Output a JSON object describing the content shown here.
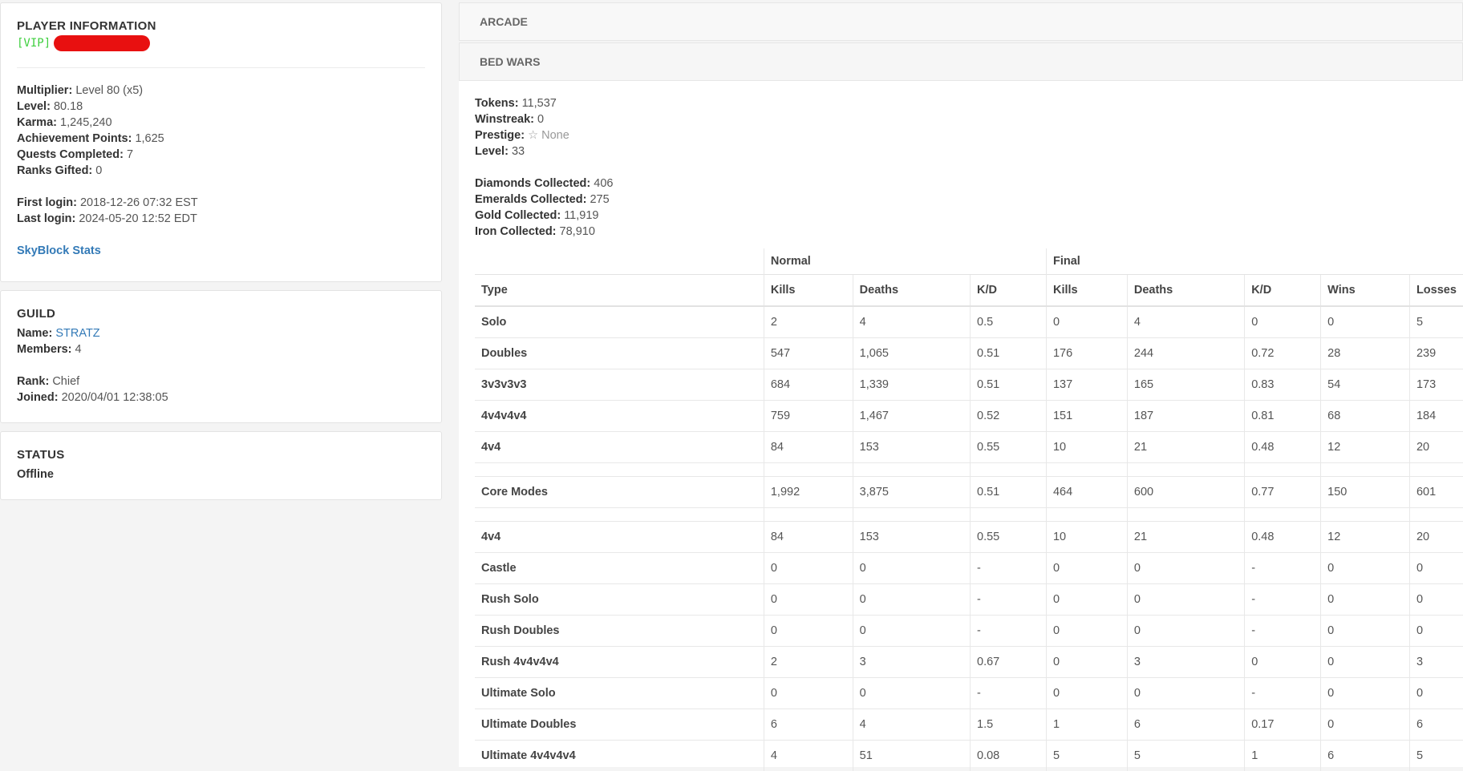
{
  "player": {
    "title": "PLAYER INFORMATION",
    "rank_tag": "[VIP]",
    "stats": [
      {
        "label": "Multiplier:",
        "value": "Level 80 (x5)"
      },
      {
        "label": "Level:",
        "value": "80.18"
      },
      {
        "label": "Karma:",
        "value": "1,245,240"
      },
      {
        "label": "Achievement Points:",
        "value": "1,625"
      },
      {
        "label": "Quests Completed:",
        "value": "7"
      },
      {
        "label": "Ranks Gifted:",
        "value": "0"
      }
    ],
    "logins": [
      {
        "label": "First login:",
        "value": "2018-12-26 07:32 EST"
      },
      {
        "label": "Last login:",
        "value": "2024-05-20 12:52 EDT"
      }
    ],
    "skyblock_link": "SkyBlock Stats"
  },
  "guild": {
    "title": "GUILD",
    "name_label": "Name:",
    "name_value": "STRATZ",
    "members_label": "Members:",
    "members_value": "4",
    "rank_label": "Rank:",
    "rank_value": "Chief",
    "joined_label": "Joined:",
    "joined_value": "2020/04/01 12:38:05"
  },
  "status": {
    "title": "STATUS",
    "value": "Offline"
  },
  "arcade": {
    "title": "ARCADE"
  },
  "bedwars": {
    "title": "BED WARS",
    "stats1": [
      {
        "label": "Tokens:",
        "value": "11,537"
      },
      {
        "label": "Winstreak:",
        "value": "0"
      },
      {
        "label": "Prestige:",
        "value": "☆ None"
      },
      {
        "label": "Level:",
        "value": "33"
      }
    ],
    "stats2": [
      {
        "label": "Diamonds Collected:",
        "value": "406"
      },
      {
        "label": "Emeralds Collected:",
        "value": "275"
      },
      {
        "label": "Gold Collected:",
        "value": "11,919"
      },
      {
        "label": "Iron Collected:",
        "value": "78,910"
      }
    ],
    "table": {
      "group_normal": "Normal",
      "group_final": "Final",
      "headers": [
        "Type",
        "Kills",
        "Deaths",
        "K/D",
        "Kills",
        "Deaths",
        "K/D",
        "Wins",
        "Losses"
      ],
      "rows": [
        [
          "Solo",
          "2",
          "4",
          "0.5",
          "0",
          "4",
          "0",
          "0",
          "5"
        ],
        [
          "Doubles",
          "547",
          "1,065",
          "0.51",
          "176",
          "244",
          "0.72",
          "28",
          "239"
        ],
        [
          "3v3v3v3",
          "684",
          "1,339",
          "0.51",
          "137",
          "165",
          "0.83",
          "54",
          "173"
        ],
        [
          "4v4v4v4",
          "759",
          "1,467",
          "0.52",
          "151",
          "187",
          "0.81",
          "68",
          "184"
        ],
        [
          "4v4",
          "84",
          "153",
          "0.55",
          "10",
          "21",
          "0.48",
          "12",
          "20"
        ]
      ],
      "core_row": [
        "Core Modes",
        "1,992",
        "3,875",
        "0.51",
        "464",
        "600",
        "0.77",
        "150",
        "601"
      ],
      "extra_rows": [
        [
          "4v4",
          "84",
          "153",
          "0.55",
          "10",
          "21",
          "0.48",
          "12",
          "20"
        ],
        [
          "Castle",
          "0",
          "0",
          "-",
          "0",
          "0",
          "-",
          "0",
          "0"
        ],
        [
          "Rush Solo",
          "0",
          "0",
          "-",
          "0",
          "0",
          "-",
          "0",
          "0"
        ],
        [
          "Rush Doubles",
          "0",
          "0",
          "-",
          "0",
          "0",
          "-",
          "0",
          "0"
        ],
        [
          "Rush 4v4v4v4",
          "2",
          "3",
          "0.67",
          "0",
          "3",
          "0",
          "0",
          "3"
        ],
        [
          "Ultimate Solo",
          "0",
          "0",
          "-",
          "0",
          "0",
          "-",
          "0",
          "0"
        ],
        [
          "Ultimate Doubles",
          "6",
          "4",
          "1.5",
          "1",
          "6",
          "0.17",
          "0",
          "6"
        ],
        [
          "Ultimate 4v4v4v4",
          "4",
          "51",
          "0.08",
          "5",
          "5",
          "1",
          "6",
          "5"
        ]
      ]
    }
  }
}
